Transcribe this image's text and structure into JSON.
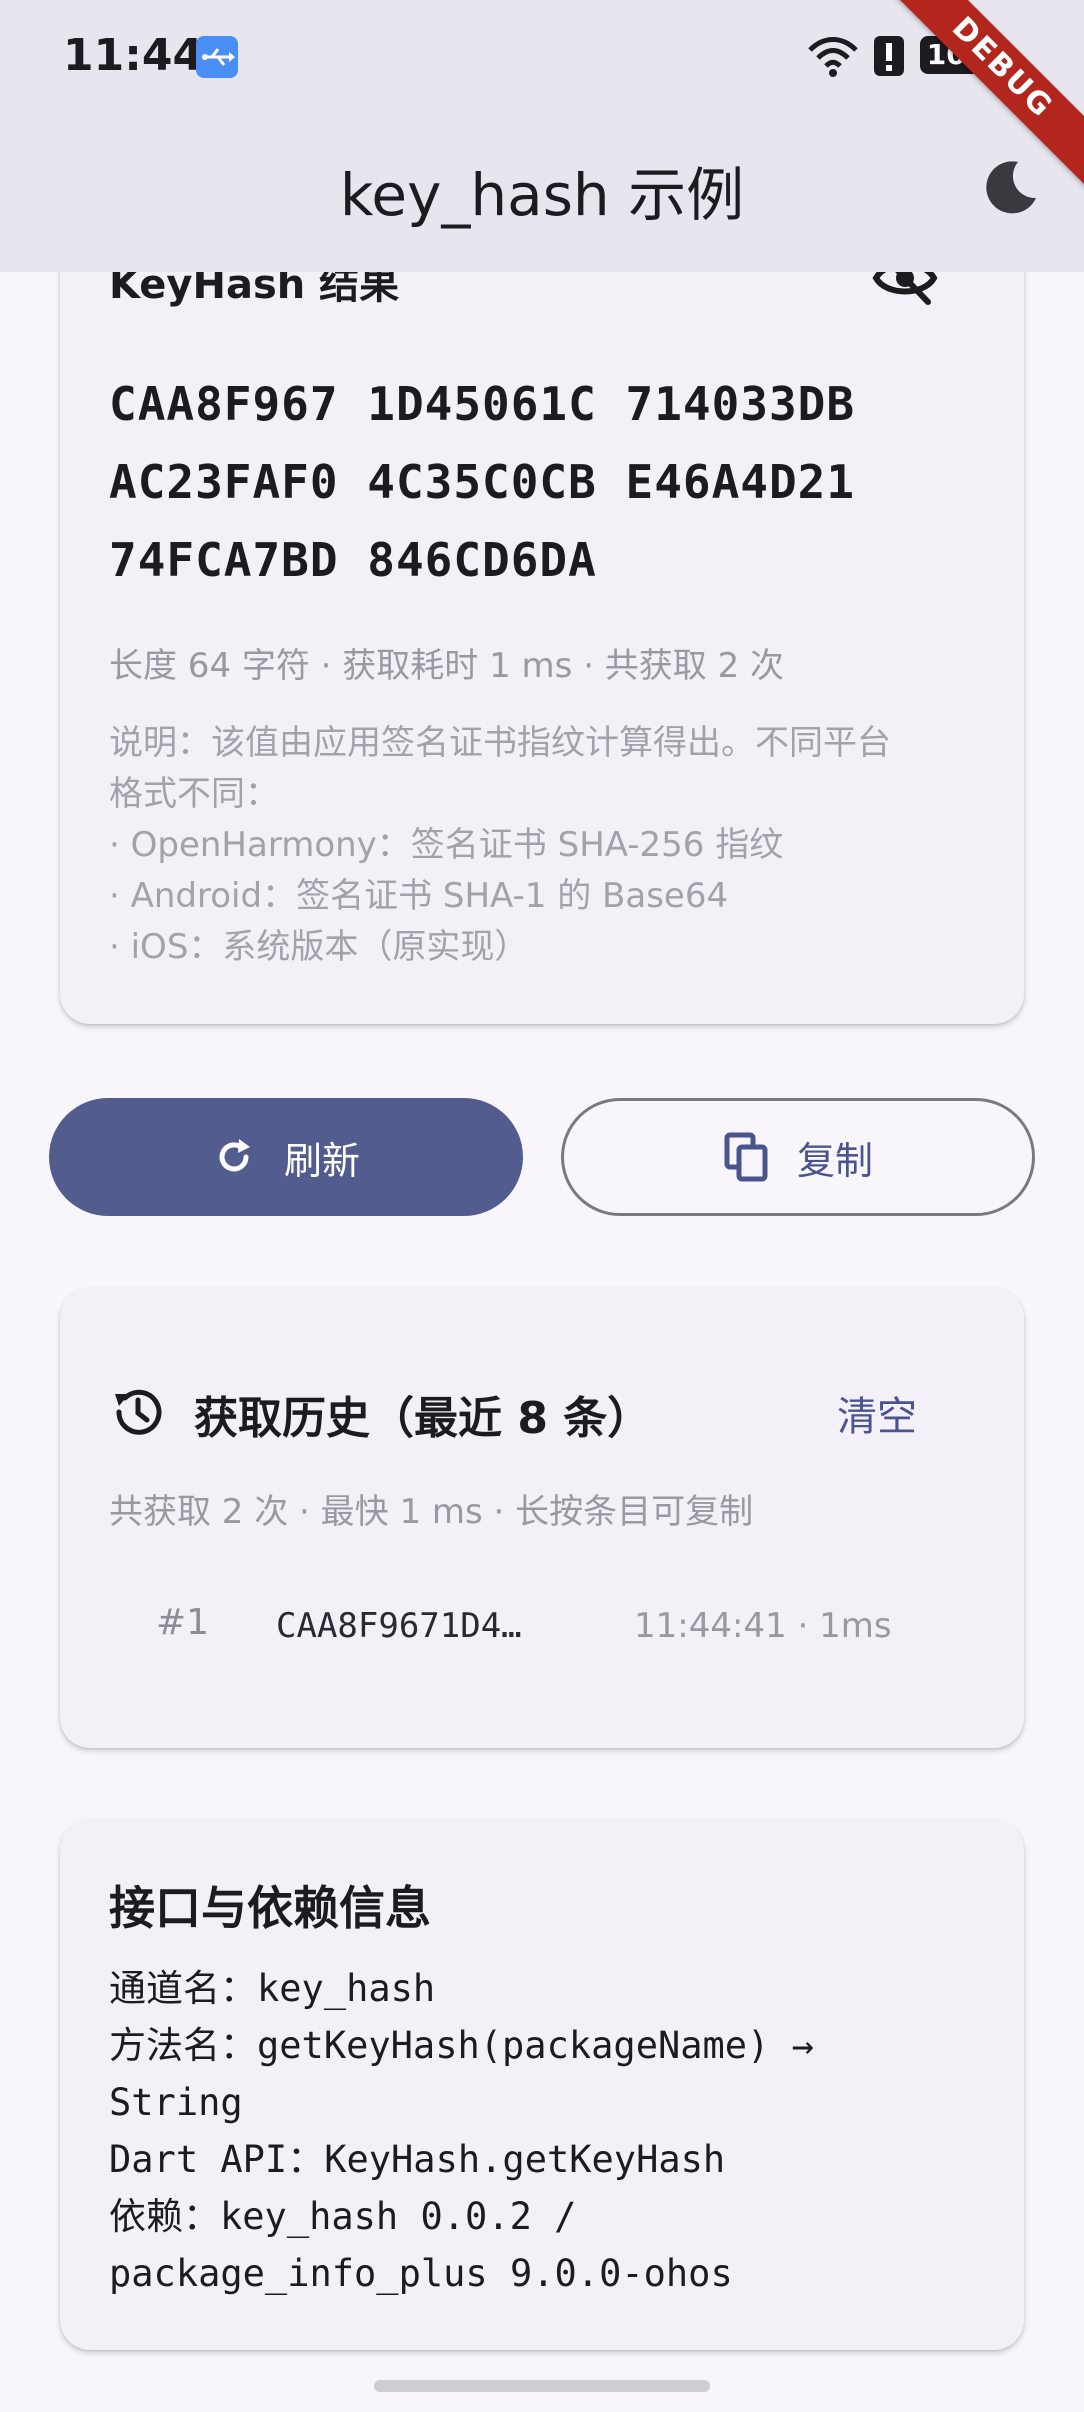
{
  "status_bar": {
    "time": "11:44",
    "battery": "100"
  },
  "app_bar": {
    "title": "key_hash 示例"
  },
  "debug_banner": "DEBUG",
  "result": {
    "title": "KeyHash 结果",
    "hash_lines": [
      "CAA8F967 1D45061C 714033DB",
      "AC23FAF0 4C35C0CB E46A4D21",
      "74FCA7BD 846CD6DA"
    ],
    "meta": "长度 64 字符 · 获取耗时 1 ms · 共获取 2 次",
    "description_lines": [
      "说明：该值由应用签名证书指纹计算得出。不同平台",
      "格式不同：",
      "· OpenHarmony：签名证书 SHA-256 指纹",
      "· Android：签名证书 SHA-1 的 Base64",
      "· iOS：系统版本（原实现）"
    ]
  },
  "actions": {
    "refresh_label": "刷新",
    "copy_label": "复制"
  },
  "history": {
    "title": "获取历史（最近 8 条）",
    "clear_label": "清空",
    "meta": "共获取 2 次 · 最快 1 ms · 长按条目可复制",
    "items": [
      {
        "index": "#1",
        "hash": "CAA8F9671D4…",
        "time": "11:44:41 · 1ms"
      }
    ]
  },
  "api_info": {
    "title": "接口与依赖信息",
    "lines": [
      "通道名：key_hash",
      "方法名：getKeyHash(packageName) →",
      "String",
      "Dart API：KeyHash.getKeyHash",
      "依赖：key_hash 0.0.2 /",
      "package_info_plus 9.0.0-ohos"
    ]
  },
  "icons": {
    "visibility": "visibility-off-icon",
    "theme": "dark-mode-moon-icon",
    "refresh": "refresh-icon",
    "copy": "copy-icon",
    "history": "history-icon"
  },
  "colors": {
    "primary": "#525c8e",
    "primary_text": "#4a5590",
    "app_bar_bg": "#e7e5ee",
    "card_bg": "#f3f1f7",
    "page_bg": "#f8f6fb",
    "debug": "#b3261e"
  }
}
